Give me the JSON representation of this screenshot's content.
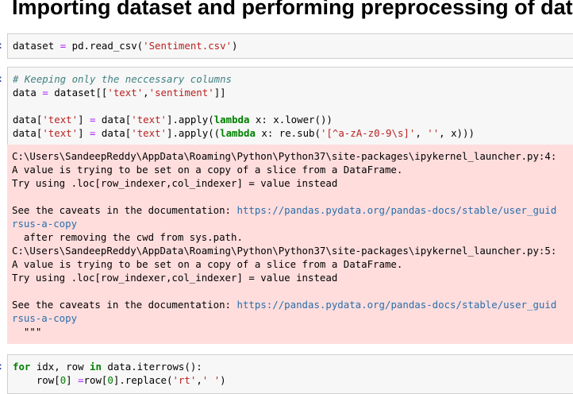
{
  "page_title": "Importing dataset and performing preprocessing of data",
  "cells": [
    {
      "type": "code",
      "lines": [
        [
          {
            "t": "dataset "
          },
          {
            "t": "=",
            "c": "op"
          },
          {
            "t": " pd.read_csv("
          },
          {
            "t": "'Sentiment.csv'",
            "c": "str"
          },
          {
            "t": ")"
          }
        ]
      ]
    },
    {
      "type": "code",
      "lines": [
        [
          {
            "t": "# Keeping only the neccessary columns",
            "c": "cmt"
          }
        ],
        [
          {
            "t": "data "
          },
          {
            "t": "=",
            "c": "op"
          },
          {
            "t": " dataset[["
          },
          {
            "t": "'text'",
            "c": "str"
          },
          {
            "t": ","
          },
          {
            "t": "'sentiment'",
            "c": "str"
          },
          {
            "t": "]]"
          }
        ],
        [
          {
            "t": ""
          }
        ],
        [
          {
            "t": "data["
          },
          {
            "t": "'text'",
            "c": "str"
          },
          {
            "t": "] "
          },
          {
            "t": "=",
            "c": "op"
          },
          {
            "t": " data["
          },
          {
            "t": "'text'",
            "c": "str"
          },
          {
            "t": "].apply("
          },
          {
            "t": "lambda",
            "c": "kw"
          },
          {
            "t": " x: x.lower())"
          }
        ],
        [
          {
            "t": "data["
          },
          {
            "t": "'text'",
            "c": "str"
          },
          {
            "t": "] "
          },
          {
            "t": "=",
            "c": "op"
          },
          {
            "t": " data["
          },
          {
            "t": "'text'",
            "c": "str"
          },
          {
            "t": "].apply(("
          },
          {
            "t": "lambda",
            "c": "kw"
          },
          {
            "t": " x: re.sub("
          },
          {
            "t": "'[^a-zA-z0-9\\s]'",
            "c": "str"
          },
          {
            "t": ", "
          },
          {
            "t": "''",
            "c": "str"
          },
          {
            "t": ", x)))"
          }
        ]
      ]
    },
    {
      "type": "code",
      "lines": [
        [
          {
            "t": "for",
            "c": "kw"
          },
          {
            "t": " idx, row "
          },
          {
            "t": "in",
            "c": "kw"
          },
          {
            "t": " data.iterrows():"
          }
        ],
        [
          {
            "t": "    row["
          },
          {
            "t": "0",
            "c": "num"
          },
          {
            "t": "] "
          },
          {
            "t": "=",
            "c": "op"
          },
          {
            "t": "row["
          },
          {
            "t": "0",
            "c": "num"
          },
          {
            "t": "].replace("
          },
          {
            "t": "'rt'",
            "c": "str"
          },
          {
            "t": ","
          },
          {
            "t": "' '",
            "c": "str"
          },
          {
            "t": ")"
          }
        ]
      ]
    }
  ],
  "stderr": {
    "lines": [
      [
        {
          "t": "C:\\Users\\SandeepReddy\\AppData\\Roaming\\Python\\Python37\\site-packages\\ipykernel_launcher.py:4:"
        }
      ],
      [
        {
          "t": "A value is trying to be set on a copy of a slice from a DataFrame."
        }
      ],
      [
        {
          "t": "Try using .loc[row_indexer,col_indexer] = value instead"
        }
      ],
      [
        {
          "t": ""
        }
      ],
      [
        {
          "t": "See the caveats in the documentation: "
        },
        {
          "t": "https://pandas.pydata.org/pandas-docs/stable/user_guid",
          "c": "link"
        }
      ],
      [
        {
          "t": "rsus-a-copy",
          "c": "link"
        }
      ],
      [
        {
          "t": "  after removing the cwd from sys.path."
        }
      ],
      [
        {
          "t": "C:\\Users\\SandeepReddy\\AppData\\Roaming\\Python\\Python37\\site-packages\\ipykernel_launcher.py:5:"
        }
      ],
      [
        {
          "t": "A value is trying to be set on a copy of a slice from a DataFrame."
        }
      ],
      [
        {
          "t": "Try using .loc[row_indexer,col_indexer] = value instead"
        }
      ],
      [
        {
          "t": ""
        }
      ],
      [
        {
          "t": "See the caveats in the documentation: "
        },
        {
          "t": "https://pandas.pydata.org/pandas-docs/stable/user_guid",
          "c": "link"
        }
      ],
      [
        {
          "t": "rsus-a-copy",
          "c": "link"
        }
      ],
      [
        {
          "t": "  \"\"\""
        }
      ]
    ]
  }
}
